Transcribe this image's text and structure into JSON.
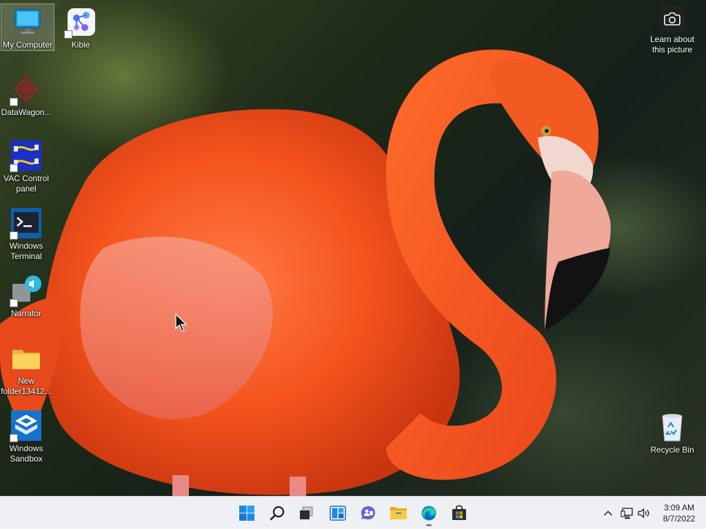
{
  "desktop": {
    "icons": [
      {
        "label": "My Computer"
      },
      {
        "label": "Kible"
      },
      {
        "label": "DataWagon..."
      },
      {
        "label": "VAC Control panel"
      },
      {
        "label": "Windows Terminal"
      },
      {
        "label": "Narrator"
      },
      {
        "label": "New folder13412..."
      },
      {
        "label": "Windows Sandbox"
      },
      {
        "label": "Recycle Bin"
      }
    ],
    "spotlight": {
      "label": "Learn about this picture",
      "icon": "camera-icon"
    }
  },
  "taskbar": {
    "apps": [
      {
        "name": "start",
        "icon": "windows-logo-icon"
      },
      {
        "name": "search",
        "icon": "search-icon"
      },
      {
        "name": "task-view",
        "icon": "task-view-icon"
      },
      {
        "name": "widgets",
        "icon": "widgets-icon"
      },
      {
        "name": "chat",
        "icon": "chat-icon"
      },
      {
        "name": "file-explorer",
        "icon": "folder-icon"
      },
      {
        "name": "edge",
        "icon": "edge-icon"
      },
      {
        "name": "store",
        "icon": "store-icon"
      }
    ],
    "tray": {
      "icons": [
        "chevron-up-icon",
        "network-icon",
        "volume-icon"
      ]
    },
    "clock": {
      "time": "3:09 AM",
      "date": "8/7/2022"
    }
  },
  "colors": {
    "accent": "#0067c0",
    "taskbar_bg": "#eef0f3",
    "flamingo": "#ff5a1f"
  }
}
